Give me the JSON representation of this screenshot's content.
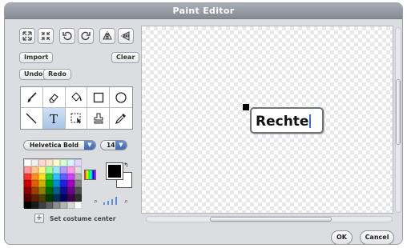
{
  "window": {
    "title": "Paint Editor"
  },
  "toolbar_icons": [
    "grow-icon",
    "shrink-icon",
    "rotate-left-icon",
    "rotate-right-icon",
    "flip-horizontal-icon",
    "flip-vertical-icon"
  ],
  "buttons": {
    "import": "Import",
    "clear": "Clear",
    "undo": "Undo",
    "redo": "Redo",
    "ok": "OK",
    "cancel": "Cancel"
  },
  "tools": [
    "paintbrush",
    "eraser",
    "fill",
    "rectangle",
    "ellipse",
    "line",
    "text",
    "select",
    "stamp",
    "eyedropper"
  ],
  "active_tool": "text",
  "font": {
    "name": "Helvetica Bold",
    "size": "14"
  },
  "canvas": {
    "text": "Rechte"
  },
  "costume_center_label": "Set costume center",
  "colors": {
    "foreground": "#000000",
    "background": "#ffffff",
    "palette": [
      "#ffffff",
      "#f0f0f0",
      "#ffd6d6",
      "#ffe7c9",
      "#fffbd0",
      "#d6ffd6",
      "#d6f5ff",
      "#e6d6ff",
      "#ff9a9a",
      "#ffc48a",
      "#fff38a",
      "#9aff9a",
      "#9ae8ff",
      "#b59aff",
      "#ff9ae3",
      "#dcdcdc",
      "#ff3030",
      "#ff9020",
      "#ffe020",
      "#30d030",
      "#30c0ff",
      "#6060ff",
      "#d040ff",
      "#b0b0b0",
      "#d00000",
      "#e06000",
      "#d0b000",
      "#00a000",
      "#0090d0",
      "#2020e0",
      "#a000c0",
      "#808080",
      "#900000",
      "#a04000",
      "#908000",
      "#006800",
      "#006090",
      "#101090",
      "#700090",
      "#505050",
      "#500000",
      "#602000",
      "#504000",
      "#003800",
      "#003050",
      "#000060",
      "#400050",
      "#303030",
      "#000000",
      "#1a1a1a",
      "#404040",
      "#606060",
      "#8c8c8c",
      "#b4b4b4",
      "#d8d8d8",
      "#ffffff"
    ]
  }
}
